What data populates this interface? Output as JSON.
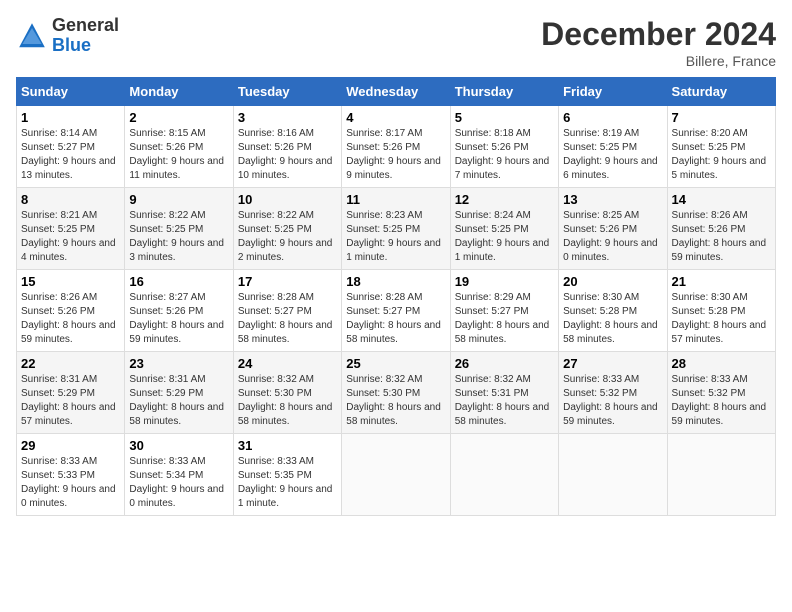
{
  "header": {
    "logo_line1": "General",
    "logo_line2": "Blue",
    "month_title": "December 2024",
    "location": "Billere, France"
  },
  "weekdays": [
    "Sunday",
    "Monday",
    "Tuesday",
    "Wednesday",
    "Thursday",
    "Friday",
    "Saturday"
  ],
  "weeks": [
    [
      {
        "day": "1",
        "sunrise": "Sunrise: 8:14 AM",
        "sunset": "Sunset: 5:27 PM",
        "daylight": "Daylight: 9 hours and 13 minutes."
      },
      {
        "day": "2",
        "sunrise": "Sunrise: 8:15 AM",
        "sunset": "Sunset: 5:26 PM",
        "daylight": "Daylight: 9 hours and 11 minutes."
      },
      {
        "day": "3",
        "sunrise": "Sunrise: 8:16 AM",
        "sunset": "Sunset: 5:26 PM",
        "daylight": "Daylight: 9 hours and 10 minutes."
      },
      {
        "day": "4",
        "sunrise": "Sunrise: 8:17 AM",
        "sunset": "Sunset: 5:26 PM",
        "daylight": "Daylight: 9 hours and 9 minutes."
      },
      {
        "day": "5",
        "sunrise": "Sunrise: 8:18 AM",
        "sunset": "Sunset: 5:26 PM",
        "daylight": "Daylight: 9 hours and 7 minutes."
      },
      {
        "day": "6",
        "sunrise": "Sunrise: 8:19 AM",
        "sunset": "Sunset: 5:25 PM",
        "daylight": "Daylight: 9 hours and 6 minutes."
      },
      {
        "day": "7",
        "sunrise": "Sunrise: 8:20 AM",
        "sunset": "Sunset: 5:25 PM",
        "daylight": "Daylight: 9 hours and 5 minutes."
      }
    ],
    [
      {
        "day": "8",
        "sunrise": "Sunrise: 8:21 AM",
        "sunset": "Sunset: 5:25 PM",
        "daylight": "Daylight: 9 hours and 4 minutes."
      },
      {
        "day": "9",
        "sunrise": "Sunrise: 8:22 AM",
        "sunset": "Sunset: 5:25 PM",
        "daylight": "Daylight: 9 hours and 3 minutes."
      },
      {
        "day": "10",
        "sunrise": "Sunrise: 8:22 AM",
        "sunset": "Sunset: 5:25 PM",
        "daylight": "Daylight: 9 hours and 2 minutes."
      },
      {
        "day": "11",
        "sunrise": "Sunrise: 8:23 AM",
        "sunset": "Sunset: 5:25 PM",
        "daylight": "Daylight: 9 hours and 1 minute."
      },
      {
        "day": "12",
        "sunrise": "Sunrise: 8:24 AM",
        "sunset": "Sunset: 5:25 PM",
        "daylight": "Daylight: 9 hours and 1 minute."
      },
      {
        "day": "13",
        "sunrise": "Sunrise: 8:25 AM",
        "sunset": "Sunset: 5:26 PM",
        "daylight": "Daylight: 9 hours and 0 minutes."
      },
      {
        "day": "14",
        "sunrise": "Sunrise: 8:26 AM",
        "sunset": "Sunset: 5:26 PM",
        "daylight": "Daylight: 8 hours and 59 minutes."
      }
    ],
    [
      {
        "day": "15",
        "sunrise": "Sunrise: 8:26 AM",
        "sunset": "Sunset: 5:26 PM",
        "daylight": "Daylight: 8 hours and 59 minutes."
      },
      {
        "day": "16",
        "sunrise": "Sunrise: 8:27 AM",
        "sunset": "Sunset: 5:26 PM",
        "daylight": "Daylight: 8 hours and 59 minutes."
      },
      {
        "day": "17",
        "sunrise": "Sunrise: 8:28 AM",
        "sunset": "Sunset: 5:27 PM",
        "daylight": "Daylight: 8 hours and 58 minutes."
      },
      {
        "day": "18",
        "sunrise": "Sunrise: 8:28 AM",
        "sunset": "Sunset: 5:27 PM",
        "daylight": "Daylight: 8 hours and 58 minutes."
      },
      {
        "day": "19",
        "sunrise": "Sunrise: 8:29 AM",
        "sunset": "Sunset: 5:27 PM",
        "daylight": "Daylight: 8 hours and 58 minutes."
      },
      {
        "day": "20",
        "sunrise": "Sunrise: 8:30 AM",
        "sunset": "Sunset: 5:28 PM",
        "daylight": "Daylight: 8 hours and 58 minutes."
      },
      {
        "day": "21",
        "sunrise": "Sunrise: 8:30 AM",
        "sunset": "Sunset: 5:28 PM",
        "daylight": "Daylight: 8 hours and 57 minutes."
      }
    ],
    [
      {
        "day": "22",
        "sunrise": "Sunrise: 8:31 AM",
        "sunset": "Sunset: 5:29 PM",
        "daylight": "Daylight: 8 hours and 57 minutes."
      },
      {
        "day": "23",
        "sunrise": "Sunrise: 8:31 AM",
        "sunset": "Sunset: 5:29 PM",
        "daylight": "Daylight: 8 hours and 58 minutes."
      },
      {
        "day": "24",
        "sunrise": "Sunrise: 8:32 AM",
        "sunset": "Sunset: 5:30 PM",
        "daylight": "Daylight: 8 hours and 58 minutes."
      },
      {
        "day": "25",
        "sunrise": "Sunrise: 8:32 AM",
        "sunset": "Sunset: 5:30 PM",
        "daylight": "Daylight: 8 hours and 58 minutes."
      },
      {
        "day": "26",
        "sunrise": "Sunrise: 8:32 AM",
        "sunset": "Sunset: 5:31 PM",
        "daylight": "Daylight: 8 hours and 58 minutes."
      },
      {
        "day": "27",
        "sunrise": "Sunrise: 8:33 AM",
        "sunset": "Sunset: 5:32 PM",
        "daylight": "Daylight: 8 hours and 59 minutes."
      },
      {
        "day": "28",
        "sunrise": "Sunrise: 8:33 AM",
        "sunset": "Sunset: 5:32 PM",
        "daylight": "Daylight: 8 hours and 59 minutes."
      }
    ],
    [
      {
        "day": "29",
        "sunrise": "Sunrise: 8:33 AM",
        "sunset": "Sunset: 5:33 PM",
        "daylight": "Daylight: 9 hours and 0 minutes."
      },
      {
        "day": "30",
        "sunrise": "Sunrise: 8:33 AM",
        "sunset": "Sunset: 5:34 PM",
        "daylight": "Daylight: 9 hours and 0 minutes."
      },
      {
        "day": "31",
        "sunrise": "Sunrise: 8:33 AM",
        "sunset": "Sunset: 5:35 PM",
        "daylight": "Daylight: 9 hours and 1 minute."
      },
      null,
      null,
      null,
      null
    ]
  ]
}
